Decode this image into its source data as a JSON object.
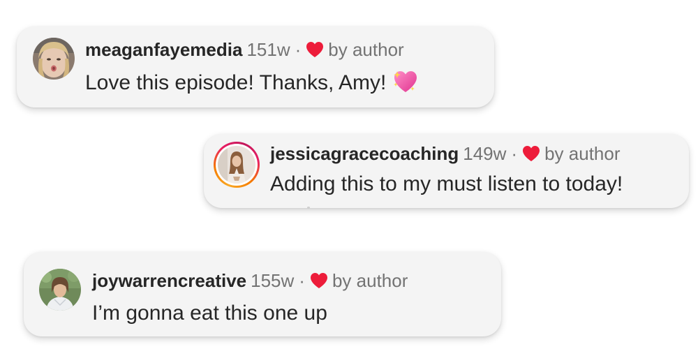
{
  "comments": [
    {
      "username": "meaganfayemedia",
      "age": "151w",
      "separator": "·",
      "liked_by_label": "by author",
      "text": "Love this episode! Thanks, Amy!",
      "emoji_icon": "sparkling-heart-icon",
      "avatar_icon": "avatar-photo-icon"
    },
    {
      "username": "jessicagracecoaching",
      "age": "149w",
      "separator": "·",
      "liked_by_label": "by author",
      "text": "Adding this to my must listen to today!",
      "avatar_icon": "avatar-photo-icon",
      "has_story_ring": true
    },
    {
      "username": "joywarrencreative",
      "age": "155w",
      "separator": "·",
      "liked_by_label": "by author",
      "text": "I’m gonna eat this one up",
      "avatar_icon": "avatar-photo-icon"
    }
  ],
  "colors": {
    "card_background": "#f4f4f4",
    "heart": "#ed1c3a",
    "username": "#262626",
    "meta": "#737373",
    "story_ring_start": "#f9a825",
    "story_ring_end": "#c2185b"
  }
}
